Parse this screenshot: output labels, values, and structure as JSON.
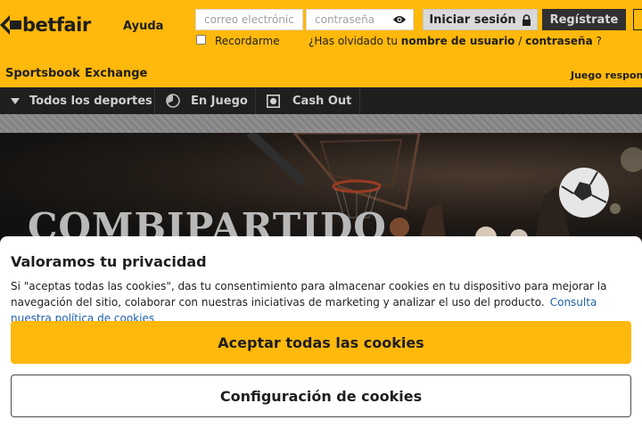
{
  "header": {
    "logo_text": "betfair",
    "help_link": "Ayuda",
    "email_placeholder": "correo electrónico",
    "password_placeholder": "contraseña",
    "login_button": "Iniciar sesión",
    "register_button": "Regístrate",
    "remember_label": "Recordarme",
    "forgot_prefix": "¿Has olvidado tu ",
    "forgot_username": "nombre de usuario",
    "forgot_sep": " / ",
    "forgot_password": "contraseña",
    "forgot_suffix": " ?",
    "product_tabs": [
      "Sportsbook",
      "Exchange"
    ],
    "responsible_gaming": "Juego responsable"
  },
  "nav": {
    "items": [
      {
        "label": "Todos los deportes",
        "icon": "caret-down-icon"
      },
      {
        "label": "En Juego",
        "icon": "clock-icon"
      },
      {
        "label": "Cash Out",
        "icon": "cash-out-icon"
      }
    ]
  },
  "hero": {
    "title": "COMBIPARTIDO"
  },
  "cookie_banner": {
    "title": "Valoramos tu privacidad",
    "text": "Si \"aceptas todas las cookies\", das tu consentimiento para almacenar cookies en tu dispositivo para mejorar la navegación del sitio, colaborar con nuestras iniciativas de marketing y analizar el uso del producto.",
    "policy_link": "Consulta nuestra política de cookies",
    "accept_button": "Aceptar todas las cookies",
    "settings_button": "Configuración de cookies"
  },
  "colors": {
    "brand_yellow": "#ffb80c",
    "dark": "#1f1f1f",
    "link_blue": "#1f5fa8"
  }
}
